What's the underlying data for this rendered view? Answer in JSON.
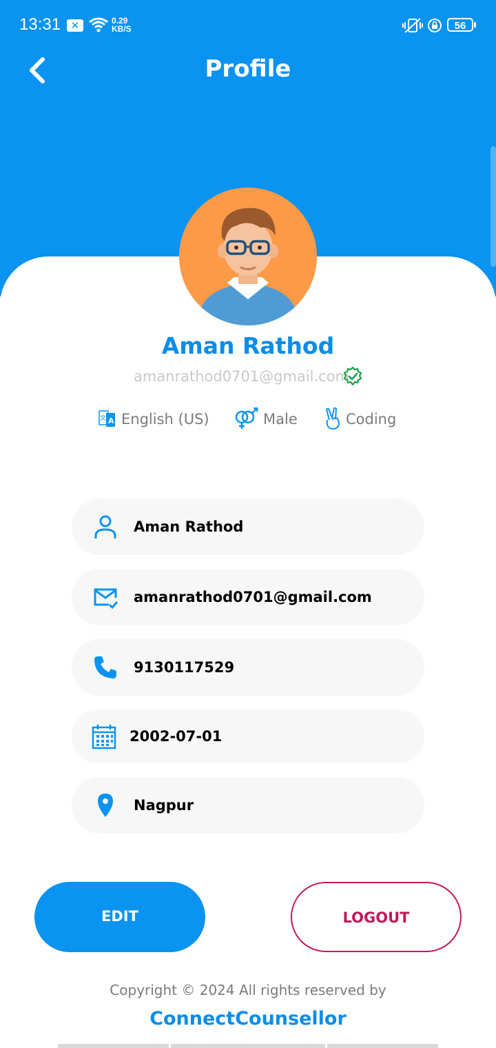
{
  "status_bar": {
    "time": "13:31",
    "speed_value": "0.29",
    "speed_unit": "KB/S",
    "battery": "56"
  },
  "header": {
    "title": "Profile"
  },
  "profile": {
    "name": "Aman Rathod",
    "email": "amanrathod0701@gmail.com",
    "chips": [
      {
        "icon": "translate-icon",
        "label": "English (US)"
      },
      {
        "icon": "gender-icon",
        "label": "Male"
      },
      {
        "icon": "peace-hand-icon",
        "label": "Coding"
      }
    ]
  },
  "fields": [
    {
      "icon": "person-icon",
      "value": "Aman Rathod"
    },
    {
      "icon": "email-check-icon",
      "value": "amanrathod0701@gmail.com"
    },
    {
      "icon": "phone-icon",
      "value": "9130117529"
    },
    {
      "icon": "calendar-icon",
      "value": "2002-07-01"
    },
    {
      "icon": "location-pin-icon",
      "value": "Nagpur"
    }
  ],
  "actions": {
    "edit_label": "EDIT",
    "logout_label": "LOGOUT"
  },
  "footer": {
    "copyright": "Copyright © 2024 All rights reserved by",
    "brand": "ConnectCounsellor"
  },
  "colors": {
    "primary": "#0a93f0",
    "logout": "#c2185b",
    "verified": "#1b9e4b"
  }
}
